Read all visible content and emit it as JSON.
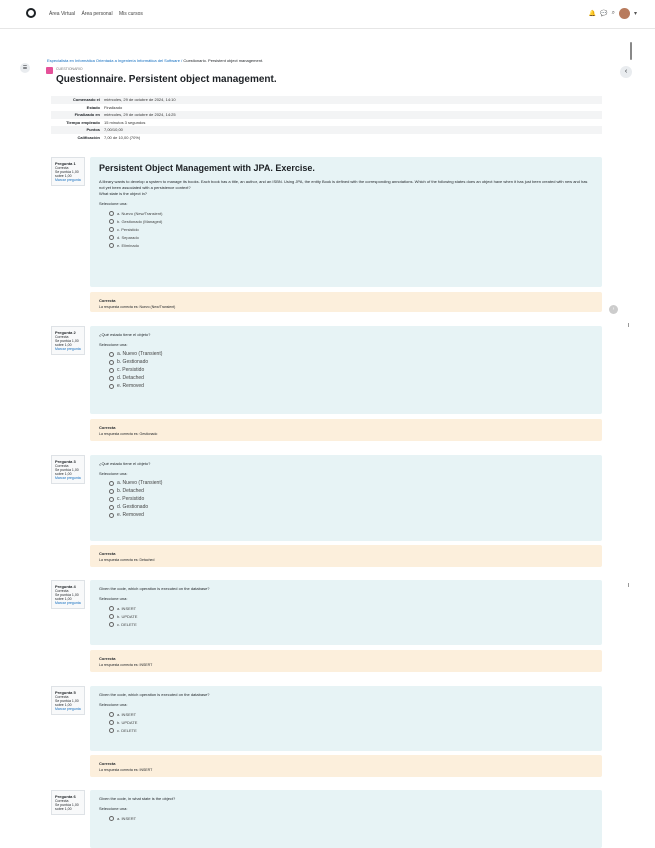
{
  "nav": {
    "links": [
      "Área Virtual",
      "Área personal",
      "Mis cursos"
    ],
    "right_icons": [
      "bell-icon",
      "chat-icon",
      "search-icon"
    ]
  },
  "breadcrumb": {
    "path": "Especialista en Informática Orientada a Ingeniería Informática del Software",
    "sep": "/",
    "current": "Cuestionario. Persistent object management."
  },
  "page": {
    "activity_label": "CUESTIONARIO",
    "title": "Questionnaire. Persistent object management."
  },
  "summary": [
    {
      "k": "Comenzado el",
      "v": "miércoles, 29 de octubre de 2024, 14:10"
    },
    {
      "k": "Estado",
      "v": "Finalizado"
    },
    {
      "k": "Finalizado en",
      "v": "miércoles, 29 de octubre de 2024, 14:25"
    },
    {
      "k": "Tiempo empleado",
      "v": "15 minutos 3 segundos"
    },
    {
      "k": "Puntos",
      "v": "7,00/10,00"
    },
    {
      "k": "Calificación",
      "v": "7,00 de 10,00 (70%)"
    }
  ],
  "questions": [
    {
      "info": {
        "num": "Pregunta 1",
        "state": "Correcta",
        "score": "Se puntúa 1,00 sobre 1,00",
        "flag": "Marcar pregunta"
      },
      "heading": "Persistent Object Management with JPA. Exercise.",
      "text": "A library wants to develop a system to manage its books. Each book has a title, an author, and an ISBN. Using JPA, the entity Book is defined with the corresponding annotations. Which of the following states does an object have when it has just been created with new and has not yet been associated with a persistence context?",
      "subtext": "What state is the object in?",
      "select_label": "Seleccione una:",
      "choices": [
        "a. Nuevo (New/Transient)",
        "b. Gestionado (Managed)",
        "c. Persistido",
        "d. Separado",
        "e. Eliminado"
      ],
      "feedback_title": "Correcta",
      "feedback_text": "La respuesta correcta es: Nuevo (New/Transient)"
    },
    {
      "info": {
        "num": "Pregunta 2",
        "state": "Correcta",
        "score": "Se puntúa 1,00 sobre 1,00",
        "flag": "Marcar pregunta"
      },
      "heading": "",
      "text": "¿Qué estado tiene el objeto?",
      "subtext": "",
      "select_label": "Seleccione una:",
      "choices": [
        "a. Nuevo (Transient)",
        "b. Gestionado",
        "c. Persistido",
        "d. Detached",
        "e. Removed"
      ],
      "feedback_title": "Correcta",
      "feedback_text": "La respuesta correcta es: Gestionado"
    },
    {
      "info": {
        "num": "Pregunta 3",
        "state": "Correcta",
        "score": "Se puntúa 1,00 sobre 1,00",
        "flag": "Marcar pregunta"
      },
      "heading": "",
      "text": "¿Qué estado tiene el objeto?",
      "subtext": "",
      "select_label": "Seleccione una:",
      "choices": [
        "a. Nuevo (Transient)",
        "b. Detached",
        "c. Persistido",
        "d. Gestionado",
        "e. Removed"
      ],
      "feedback_title": "Correcta",
      "feedback_text": "La respuesta correcta es: Detached"
    },
    {
      "info": {
        "num": "Pregunta 4",
        "state": "Correcta",
        "score": "Se puntúa 1,00 sobre 1,00",
        "flag": "Marcar pregunta"
      },
      "heading": "",
      "text": "Given the code, which operation is executed on the database?",
      "subtext": "",
      "select_label": "Seleccione una:",
      "choices": [
        "a. INSERT",
        "b. UPDATE",
        "c. DELETE"
      ],
      "feedback_title": "Correcta",
      "feedback_text": "La respuesta correcta es: INSERT"
    },
    {
      "info": {
        "num": "Pregunta 5",
        "state": "Correcta",
        "score": "Se puntúa 1,00 sobre 1,00",
        "flag": "Marcar pregunta"
      },
      "heading": "",
      "text": "Given the code, which operation is executed on the database?",
      "subtext": "",
      "select_label": "Seleccione una:",
      "choices": [
        "a. INSERT",
        "b. UPDATE",
        "c. DELETE"
      ],
      "feedback_title": "Correcta",
      "feedback_text": "La respuesta correcta es: INSERT"
    },
    {
      "info": {
        "num": "Pregunta 6",
        "state": "Correcta",
        "score": "Se puntúa 1,00 sobre 1,00",
        "flag": ""
      },
      "heading": "",
      "text": "Given the code, in what state is the object?",
      "subtext": "",
      "select_label": "Seleccione una:",
      "choices": [
        "a. INSERT"
      ],
      "feedback_title": "",
      "feedback_text": ""
    }
  ]
}
